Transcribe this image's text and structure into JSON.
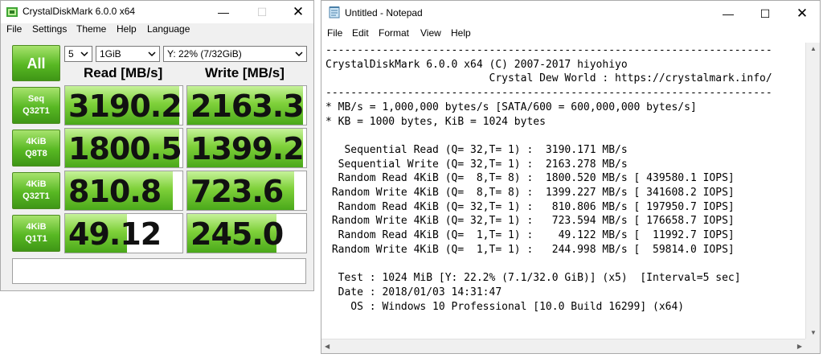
{
  "cdm": {
    "title": "CrystalDiskMark 6.0.0 x64",
    "menu": [
      "File",
      "Settings",
      "Theme",
      "Help",
      "Language"
    ],
    "count": "5",
    "size": "1GiB",
    "drive": "Y: 22% (7/32GiB)",
    "all_label": "All",
    "read_header": "Read [MB/s]",
    "write_header": "Write [MB/s]",
    "rows": [
      {
        "l1": "Seq",
        "l2": "Q32T1",
        "read": "3190.2",
        "write": "2163.3",
        "read_fill": 0.97,
        "write_fill": 0.97
      },
      {
        "l1": "4KiB",
        "l2": "Q8T8",
        "read": "1800.5",
        "write": "1399.2",
        "read_fill": 0.97,
        "write_fill": 0.97
      },
      {
        "l1": "4KiB",
        "l2": "Q32T1",
        "read": "810.8",
        "write": "723.6",
        "read_fill": 0.92,
        "write_fill": 0.9
      },
      {
        "l1": "4KiB",
        "l2": "Q1T1",
        "read": "49.12",
        "write": "245.0",
        "read_fill": 0.53,
        "write_fill": 0.75
      }
    ],
    "comment": ""
  },
  "notepad": {
    "title": "Untitled - Notepad",
    "menu": [
      "File",
      "Edit",
      "Format",
      "View",
      "Help"
    ],
    "lines": [
      "-----------------------------------------------------------------------",
      "CrystalDiskMark 6.0.0 x64 (C) 2007-2017 hiyohiyo",
      "                          Crystal Dew World : https://crystalmark.info/",
      "-----------------------------------------------------------------------",
      "* MB/s = 1,000,000 bytes/s [SATA/600 = 600,000,000 bytes/s]",
      "* KB = 1000 bytes, KiB = 1024 bytes",
      "",
      "   Sequential Read (Q= 32,T= 1) :  3190.171 MB/s",
      "  Sequential Write (Q= 32,T= 1) :  2163.278 MB/s",
      "  Random Read 4KiB (Q=  8,T= 8) :  1800.520 MB/s [ 439580.1 IOPS]",
      " Random Write 4KiB (Q=  8,T= 8) :  1399.227 MB/s [ 341608.2 IOPS]",
      "  Random Read 4KiB (Q= 32,T= 1) :   810.806 MB/s [ 197950.7 IOPS]",
      " Random Write 4KiB (Q= 32,T= 1) :   723.594 MB/s [ 176658.7 IOPS]",
      "  Random Read 4KiB (Q=  1,T= 1) :    49.122 MB/s [  11992.7 IOPS]",
      " Random Write 4KiB (Q=  1,T= 1) :   244.998 MB/s [  59814.0 IOPS]",
      "",
      "  Test : 1024 MiB [Y: 22.2% (7.1/32.0 GiB)] (x5)  [Interval=5 sec]",
      "  Date : 2018/01/03 14:31:47",
      "    OS : Windows 10 Professional [10.0 Build 16299] (x64)"
    ]
  }
}
